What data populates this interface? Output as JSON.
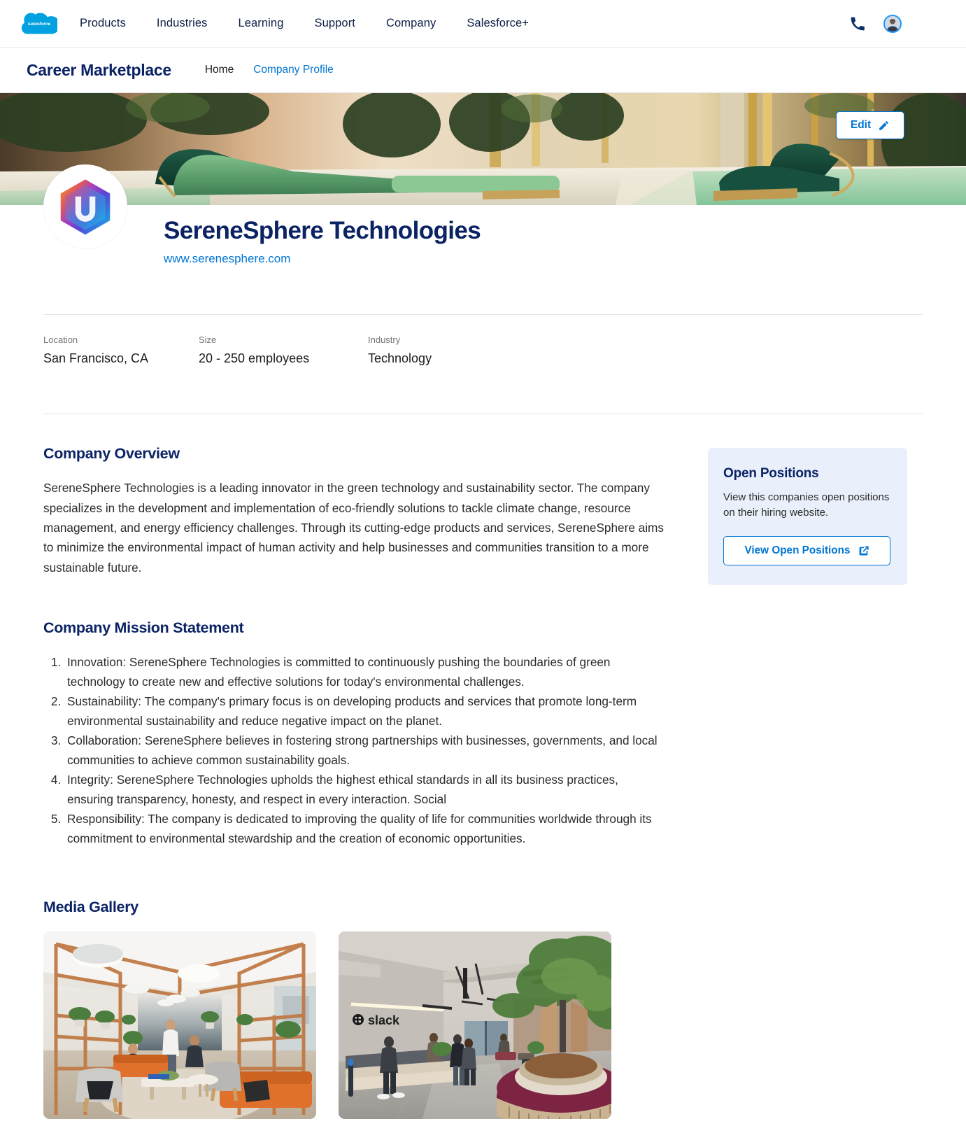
{
  "global_nav": {
    "logo_icon": "salesforce-cloud-logo",
    "logo_text": "salesforce",
    "links": [
      {
        "label": "Products"
      },
      {
        "label": "Industries"
      },
      {
        "label": "Learning"
      },
      {
        "label": "Support"
      },
      {
        "label": "Company"
      },
      {
        "label": "Salesforce+"
      }
    ],
    "phone_icon": "phone-icon",
    "avatar_icon": "user-avatar"
  },
  "app_nav": {
    "title": "Career Marketplace",
    "tabs": [
      {
        "label": "Home",
        "active": false
      },
      {
        "label": "Company Profile",
        "active": true
      }
    ]
  },
  "banner": {
    "alt": "luxury-lounge-pool-banner",
    "edit_button": {
      "label": "Edit",
      "icon": "pencil-icon"
    }
  },
  "profile": {
    "logo_icon": "serenesphere-hexagon-logo",
    "name": "SereneSphere Technologies",
    "website": "www.serenesphere.com"
  },
  "meta": [
    {
      "label": "Location",
      "value": "San Francisco, CA"
    },
    {
      "label": "Size",
      "value": "20 - 250 employees"
    },
    {
      "label": "Industry",
      "value": "Technology"
    }
  ],
  "overview": {
    "title": "Company Overview",
    "text": "SereneSphere Technologies is a leading innovator in the green technology and sustainability sector. The company specializes in the development and implementation of eco-friendly solutions to tackle climate change, resource management, and energy efficiency challenges. Through its cutting-edge products and services, SereneSphere aims to minimize the environmental impact of human activity and help businesses and communities transition to a more sustainable future."
  },
  "mission": {
    "title": "Company Mission Statement",
    "items": [
      "Innovation: SereneSphere Technologies is committed to continuously pushing the boundaries of green technology to create new and effective solutions for today's environmental challenges.",
      "Sustainability: The company's primary focus is on developing products and services that promote long-term environmental sustainability and reduce negative impact on the planet.",
      "Collaboration: SereneSphere believes in fostering strong partnerships with businesses, governments, and local communities to achieve common sustainability goals.",
      "Integrity: SereneSphere Technologies upholds the highest ethical standards in all its business practices, ensuring transparency, honesty, and respect in every interaction. Social",
      "Responsibility: The company is dedicated to improving the quality of life for communities worldwide through its commitment to environmental stewardship and the creation of economic opportunities."
    ]
  },
  "open_positions": {
    "title": "Open Positions",
    "description": "View this companies open positions on their hiring website.",
    "button_label": "View Open Positions",
    "button_icon": "external-link-icon"
  },
  "gallery": {
    "title": "Media Gallery",
    "items": [
      {
        "alt": "office-lounge-wood-frame-photo"
      },
      {
        "alt": "slack-office-lobby-photo"
      }
    ]
  },
  "colors": {
    "brand_navy": "#0b2265",
    "link_blue": "#0176d3",
    "salesforce_blue": "#00a1e0",
    "card_bg": "#eaf0fb",
    "body_text": "#2b2b2b",
    "muted_text": "#747474"
  }
}
